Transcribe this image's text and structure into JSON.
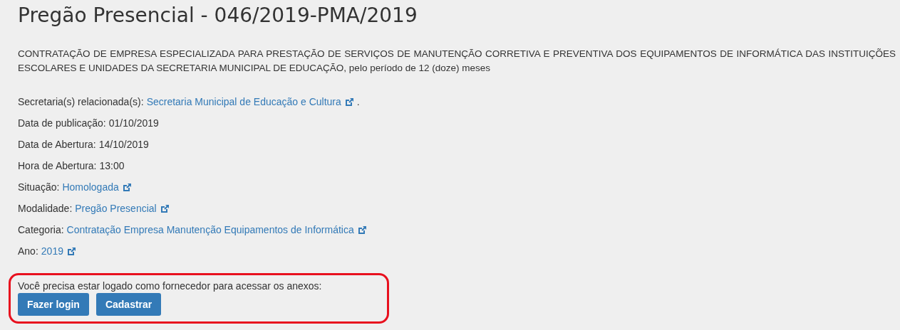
{
  "title": "Pregão Presencial - 046/2019-PMA/2019",
  "description": {
    "main": "CONTRATAÇÃO DE EMPRESA ESPECIALIZADA PARA PRESTAÇÃO DE SERVIÇOS DE MANUTENÇÃO CORRETIVA E PREVENTIVA DOS EQUIPAMENTOS DE INFORMÁTICA DAS INSTITUIÇÕES ESCOLARES E UNIDADES DA SECRETARIA MUNICIPAL DE EDUCAÇÃO",
    "rest": ", pelo período de 12 (doze) meses"
  },
  "fields": [
    {
      "label": "Secretaria(s) relacionada(s):",
      "kind": "link",
      "value": "Secretaria Municipal de Educação e Cultura",
      "suffix": "."
    },
    {
      "label": "Data de publicação:",
      "kind": "text",
      "value": "01/10/2019"
    },
    {
      "label": "Data de Abertura:",
      "kind": "text",
      "value": "14/10/2019"
    },
    {
      "label": "Hora de Abertura:",
      "kind": "text",
      "value": "13:00"
    },
    {
      "label": "Situação:",
      "kind": "link",
      "value": "Homologada"
    },
    {
      "label": "Modalidade:",
      "kind": "link",
      "value": "Pregão Presencial"
    },
    {
      "label": "Categoria:",
      "kind": "link",
      "value": "Contratação Empresa Manutenção Equipamentos de Informática"
    },
    {
      "label": "Ano:",
      "kind": "link",
      "value": "2019"
    }
  ],
  "login_notice": {
    "message": "Você precisa estar logado como fornecedor para acessar os anexos:",
    "buttons": [
      "Fazer login",
      "Cadastrar"
    ]
  }
}
